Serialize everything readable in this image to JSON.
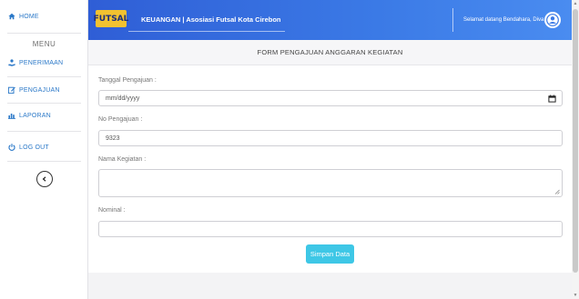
{
  "sidebar": {
    "home": "HOME",
    "menu_label": "MENU",
    "items": [
      {
        "label": "PENERIMAAN",
        "icon": "hand-coin-icon"
      },
      {
        "label": "PENGAJUAN",
        "icon": "edit-icon"
      },
      {
        "label": "LAPORAN",
        "icon": "bar-chart-icon"
      }
    ],
    "logout": "LOG OUT",
    "toggle_icon": "chevron-left-icon"
  },
  "navbar": {
    "logo_text": "FUTSAL",
    "brand": "KEUANGAN | Asosiasi Futsal Kota Cirebon",
    "welcome": "Selamat datang Bendahara, Diva"
  },
  "form": {
    "title": "FORM PENGAJUAN ANGGARAN KEGIATAN",
    "fields": {
      "tanggal": {
        "label": "Tanggal Pengajuan :",
        "value": "mm/dd/yyyy"
      },
      "no": {
        "label": "No Pengajuan :",
        "value": "9323"
      },
      "nama": {
        "label": "Nama Kegiatan :",
        "value": ""
      },
      "nominal": {
        "label": "Nominal :",
        "value": ""
      }
    },
    "submit": "Simpan Data"
  },
  "colors": {
    "accent": "#2a78c8",
    "navbar": "#3b7ae6",
    "button": "#3ec7e6",
    "logo_bg": "#f2c230"
  }
}
